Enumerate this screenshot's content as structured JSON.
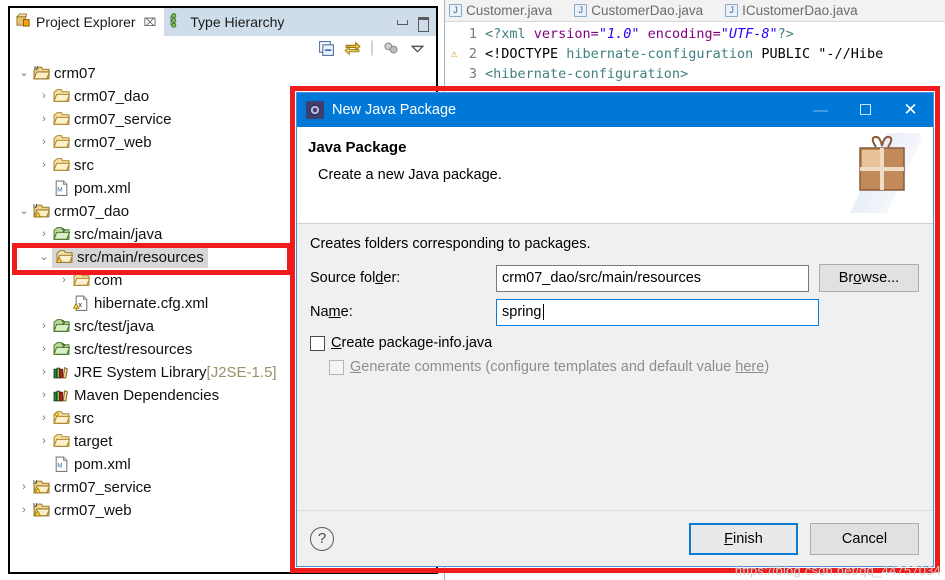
{
  "view_stack": {
    "tabs": [
      {
        "label": "Project Explorer",
        "icon": "project-explorer-icon",
        "close": "⌧",
        "active": true
      },
      {
        "label": "Type Hierarchy",
        "icon": "type-hierarchy-icon",
        "close": "",
        "active": false
      }
    ],
    "toolbar": [
      {
        "name": "collapse-all-icon"
      },
      {
        "name": "link-with-editor-icon"
      },
      {
        "name": "view-menu-filter-icon"
      },
      {
        "name": "view-menu-icon"
      }
    ],
    "window_buttons": [
      {
        "name": "minimize-view-button",
        "glyph": "minimize"
      },
      {
        "name": "maximize-view-button",
        "glyph": "maximize"
      }
    ]
  },
  "tree": {
    "rows": [
      {
        "label": "crm07",
        "indent": 0,
        "twisty": "⌄",
        "icon": "maven-project-icon",
        "selected": false,
        "suffix": ""
      },
      {
        "label": "crm07_dao",
        "indent": 1,
        "twisty": "›",
        "icon": "folder-icon",
        "selected": false,
        "suffix": ""
      },
      {
        "label": "crm07_service",
        "indent": 1,
        "twisty": "›",
        "icon": "folder-icon",
        "selected": false,
        "suffix": ""
      },
      {
        "label": "crm07_web",
        "indent": 1,
        "twisty": "›",
        "icon": "folder-icon",
        "selected": false,
        "suffix": ""
      },
      {
        "label": "src",
        "indent": 1,
        "twisty": "›",
        "icon": "folder-icon",
        "selected": false,
        "suffix": ""
      },
      {
        "label": "pom.xml",
        "indent": 1,
        "twisty": "",
        "icon": "xml-file-icon",
        "selected": false,
        "suffix": ""
      },
      {
        "label": "crm07_dao",
        "indent": 0,
        "twisty": "⌄",
        "icon": "maven-project-warning-icon",
        "selected": false,
        "suffix": ""
      },
      {
        "label": "src/main/java",
        "indent": 1,
        "twisty": "›",
        "icon": "source-folder-icon",
        "selected": false,
        "suffix": ""
      },
      {
        "label": "src/main/resources",
        "indent": 1,
        "twisty": "⌄",
        "icon": "source-folder-warning-icon",
        "selected": true,
        "suffix": ""
      },
      {
        "label": "com",
        "indent": 2,
        "twisty": "›",
        "icon": "package-folder-icon",
        "selected": false,
        "suffix": ""
      },
      {
        "label": "hibernate.cfg.xml",
        "indent": 2,
        "twisty": "",
        "icon": "xml-warning-file-icon",
        "selected": false,
        "suffix": ""
      },
      {
        "label": "src/test/java",
        "indent": 1,
        "twisty": "›",
        "icon": "source-folder-icon",
        "selected": false,
        "suffix": ""
      },
      {
        "label": "src/test/resources",
        "indent": 1,
        "twisty": "›",
        "icon": "source-folder-icon",
        "selected": false,
        "suffix": ""
      },
      {
        "label": "JRE System Library",
        "indent": 1,
        "twisty": "›",
        "icon": "library-icon",
        "selected": false,
        "suffix": " [J2SE-1.5]"
      },
      {
        "label": "Maven Dependencies",
        "indent": 1,
        "twisty": "›",
        "icon": "library-icon",
        "selected": false,
        "suffix": ""
      },
      {
        "label": "src",
        "indent": 1,
        "twisty": "›",
        "icon": "plain-folder-icon",
        "selected": false,
        "suffix": ""
      },
      {
        "label": "target",
        "indent": 1,
        "twisty": "›",
        "icon": "folder-icon",
        "selected": false,
        "suffix": ""
      },
      {
        "label": "pom.xml",
        "indent": 1,
        "twisty": "",
        "icon": "xml-file-icon",
        "selected": false,
        "suffix": ""
      },
      {
        "label": "crm07_service",
        "indent": 0,
        "twisty": "›",
        "icon": "maven-project-warning-icon",
        "selected": false,
        "suffix": ""
      },
      {
        "label": "crm07_web",
        "indent": 0,
        "twisty": "›",
        "icon": "maven-project-warning-icon",
        "selected": false,
        "suffix": ""
      }
    ]
  },
  "editor": {
    "tabs": [
      {
        "label": "Customer.java",
        "icon": "java-file-icon"
      },
      {
        "label": "CustomerDao.java",
        "icon": "java-file-icon"
      },
      {
        "label": "ICustomerDao.java",
        "icon": "java-file-icon"
      }
    ],
    "lines": [
      {
        "number": "1",
        "marker": "",
        "parts": [
          {
            "text": "<?xml ",
            "cls": "k-tag"
          },
          {
            "text": "version=",
            "cls": "k-attr"
          },
          {
            "text": "\"1.0\"",
            "cls": "k-str"
          },
          {
            "text": " encoding=",
            "cls": "k-attr"
          },
          {
            "text": "\"UTF-8\"",
            "cls": "k-str"
          },
          {
            "text": "?>",
            "cls": "k-tag"
          }
        ]
      },
      {
        "number": "2",
        "marker": "⚠",
        "parts": [
          {
            "text": "<!DOCTYPE ",
            "cls": "k-txt"
          },
          {
            "text": "hibernate-configuration",
            "cls": "k-tag"
          },
          {
            "text": " PUBLIC ",
            "cls": "k-txt"
          },
          {
            "text": "\"-//Hibe",
            "cls": "k-txt"
          }
        ]
      },
      {
        "number": "3",
        "marker": "",
        "parts": [
          {
            "text": "<hibernate-configuration>",
            "cls": "k-tag"
          }
        ]
      }
    ]
  },
  "dialog": {
    "title": "New Java Package",
    "title_icon": "new-package-wizard-icon",
    "window_buttons": [
      {
        "name": "minimize-button",
        "glyph": "—",
        "disabled": true
      },
      {
        "name": "maximize-button",
        "glyph": "☐",
        "disabled": false
      },
      {
        "name": "close-button",
        "glyph": "✕",
        "disabled": false
      }
    ],
    "header": {
      "heading": "Java Package",
      "subheading": "Create a new Java package.",
      "banner_icon": "gift-box-icon"
    },
    "note": "Creates folders corresponding to packages.",
    "fields": [
      {
        "label_pre": "Source fol",
        "label_mnemonic": "d",
        "label_post": "er:",
        "value": "crm07_dao/src/main/resources",
        "focused": false,
        "name": "source-folder-input"
      },
      {
        "label_pre": "Na",
        "label_mnemonic": "m",
        "label_post": "e:",
        "value": "spring",
        "focused": true,
        "name": "package-name-input"
      }
    ],
    "browse_button": {
      "pre": "Br",
      "mnemonic": "o",
      "post": "wse..."
    },
    "checkboxes": [
      {
        "pre": "",
        "mnemonic": "C",
        "post": "reate package-info.java",
        "checked": false,
        "disabled": false,
        "name": "create-package-info-checkbox"
      },
      {
        "pre": "",
        "mnemonic": "G",
        "post": "enerate comments (configure templates and default value ",
        "link": "here",
        "tail": ")",
        "checked": false,
        "disabled": true,
        "name": "generate-comments-checkbox"
      }
    ],
    "footer": {
      "help_glyph": "?",
      "finish": {
        "pre": "",
        "mnemonic": "F",
        "post": "inish"
      },
      "cancel": "Cancel"
    }
  },
  "watermark": "https://blog.csdn.net/qq_44757034",
  "colors": {
    "titlebar_blue": "#0078d7",
    "annotation_red": "#ee1c1c",
    "tab_blue": "#cfdcea",
    "selection_gray": "#d6d6d6",
    "focus_blue": "#0a7cd4"
  }
}
